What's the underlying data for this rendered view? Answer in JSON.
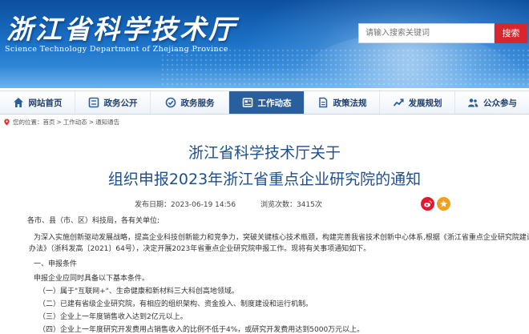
{
  "header": {
    "site_title_cn": "浙江省科学技术厅",
    "site_title_en": "Science Technology Department of Zhejiang Province",
    "search_placeholder": "请输入搜索关键词",
    "search_button": "搜索",
    "colors": {
      "banner": "#1a6fc4",
      "search_button": "#d9252b"
    }
  },
  "nav": {
    "items": [
      {
        "label": "网站首页",
        "icon": "home-icon"
      },
      {
        "label": "政务公开",
        "icon": "list-icon"
      },
      {
        "label": "政务服务",
        "icon": "service-icon"
      },
      {
        "label": "工作动态",
        "icon": "news-icon",
        "active": true
      },
      {
        "label": "政策法规",
        "icon": "document-icon"
      },
      {
        "label": "发展规划",
        "icon": "trend-icon"
      },
      {
        "label": "公众参与",
        "icon": "people-icon"
      }
    ],
    "colors": {
      "active_bg": "#2a5f9e",
      "text": "#1f3f6e"
    }
  },
  "breadcrumb": {
    "prefix": "您的位置：",
    "items": [
      "首页",
      "工作动态",
      "通知通告"
    ],
    "separator": ">"
  },
  "article": {
    "title_line1": "浙江省科学技术厅关于",
    "title_line2": "组织申报2023年浙江省重点企业研究院的通知",
    "publish_time": "发布日期：2023-06-19 14:56",
    "views": "浏览次数：3415次",
    "salutation": "各市、县（市、区）科技局，各有关单位:",
    "para1_line1": "为深入实施创新驱动发展战略，提高企业科技创新能力和竞争力，突破关键核心技术瓶颈，构建完善我省技术创新中心体系,根据《浙江省重点企业研究院建设与管理",
    "para1_line2": "办法》（浙科发高〔2021〕64号），决定开展2023年省重点企业研究院申报工作。现将有关事项通知如下。",
    "heading1": "一、申报条件",
    "intro": "申报企业应同时具备以下基本条件。",
    "conditions": [
      "（一）属于\"互联网+\"、生命健康和新材料三大科创高地领域。",
      "（二）已建有省级企业研究院，有相应的组织架构、资金投入、制度建设和运行机制。",
      "（三）企业上一年度销售收入达到2亿元以上。",
      "（四）企业上一年度研究开发费用占销售收入的比例不低于4%，或研究开发费用达到5000万元以上。"
    ],
    "colors": {
      "title": "#1e4f8c"
    }
  }
}
